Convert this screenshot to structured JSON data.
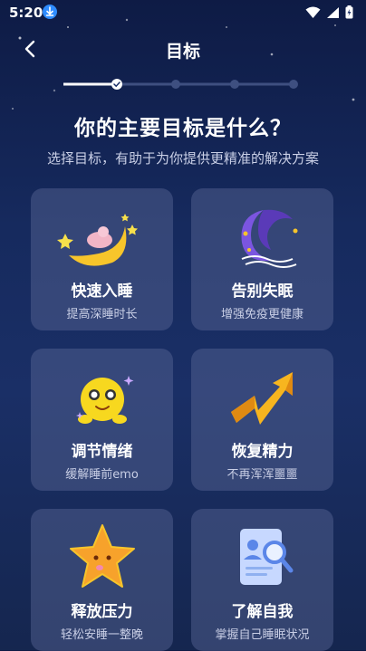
{
  "status_bar": {
    "time": "5:20"
  },
  "header": {
    "title": "目标"
  },
  "question": "你的主要目标是什么？",
  "subtitle": "选择目标，有助于为你提供更精准的解决方案",
  "progress": {
    "total_steps": 4,
    "current_step": 1
  },
  "goals": [
    {
      "title": "快速入睡",
      "subtitle": "提高深睡时长",
      "icon": "sleeping-moon-icon"
    },
    {
      "title": "告别失眠",
      "subtitle": "增强免疫更健康",
      "icon": "purple-moon-icon"
    },
    {
      "title": "调节情绪",
      "subtitle": "缓解睡前emo",
      "icon": "smiley-face-icon"
    },
    {
      "title": "恢复精力",
      "subtitle": "不再浑浑噩噩",
      "icon": "up-arrow-icon"
    },
    {
      "title": "释放压力",
      "subtitle": "轻松安睡一整晚",
      "icon": "star-character-icon"
    },
    {
      "title": "了解自我",
      "subtitle": "掌握自己睡眠状况",
      "icon": "report-search-icon"
    }
  ],
  "colors": {
    "accent_yellow": "#f7c52b",
    "card_bg": "#4a5a8a",
    "background": "#162a5e"
  }
}
